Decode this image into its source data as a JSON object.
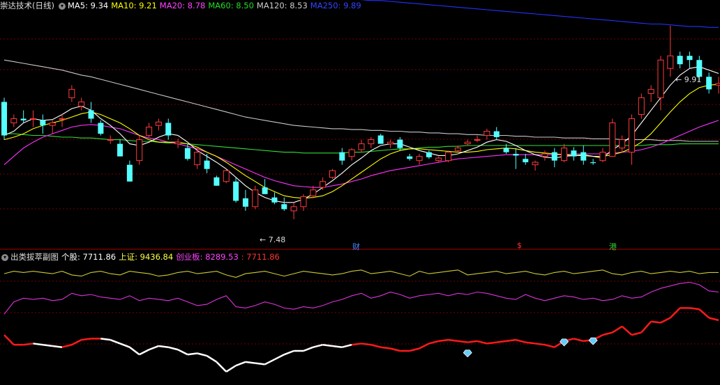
{
  "main_panel": {
    "title": "崇达技术(日线)",
    "ma_labels": [
      {
        "text": "MA5: 9.34",
        "color": "#ffffff"
      },
      {
        "text": "MA10: 9.21",
        "color": "#ffff00"
      },
      {
        "text": "MA20: 8.78",
        "color": "#ff44ff"
      },
      {
        "text": "MA60: 8.50",
        "color": "#22dd22"
      },
      {
        "text": "MA120: 8.53",
        "color": "#cccccc"
      },
      {
        "text": "MA250: 9.89",
        "color": "#3344ff"
      }
    ],
    "price_high_label": "9.91",
    "price_low_label": "7.48",
    "event_marks": [
      {
        "text": "财",
        "color": "#4488ff"
      },
      {
        "text": "$",
        "color": "#ff3333"
      },
      {
        "text": "港",
        "color": "#33cc33"
      }
    ]
  },
  "sub_panel": {
    "title": "出类拔萃副图",
    "labels": [
      {
        "text": "个股: 7711.86",
        "color": "#ffffff"
      },
      {
        "text": "上证: 9436.84",
        "color": "#ffff44"
      },
      {
        "text": "创业板: 8289.53",
        "color": "#ff44ff"
      },
      {
        "text": ": 7711.86",
        "color": "#ff3333"
      }
    ]
  },
  "colors": {
    "up": "#ff3b3b",
    "down": "#54ffff",
    "grid": "#7a0000",
    "ma5": "#ffffff",
    "ma10": "#ffff00",
    "ma20": "#ff33ff",
    "ma60": "#33dd33",
    "ma120": "#c8c8c8",
    "ma250": "#2233ff",
    "sub_yellow": "#cccc33",
    "sub_magenta": "#dd33dd",
    "sub_white": "#ffffff",
    "sub_red": "#ff1a1a",
    "diamond": "#66ccff"
  },
  "chart_data": [
    {
      "type": "candlestick",
      "title": "崇达技术(日线)",
      "y_range": [
        7.35,
        10.1
      ],
      "candles_ohlc": [
        [
          9.0,
          9.05,
          8.55,
          8.6
        ],
        [
          8.75,
          8.85,
          8.7,
          8.8
        ],
        [
          8.8,
          8.9,
          8.75,
          8.78
        ],
        [
          8.8,
          8.9,
          8.7,
          8.8
        ],
        [
          8.78,
          8.85,
          8.62,
          8.72
        ],
        [
          8.72,
          8.78,
          8.62,
          8.75
        ],
        [
          8.8,
          8.85,
          8.7,
          8.8
        ],
        [
          9.05,
          9.2,
          9.0,
          9.15
        ],
        [
          8.95,
          9.05,
          8.9,
          9.0
        ],
        [
          8.9,
          9.0,
          8.75,
          8.8
        ],
        [
          8.75,
          8.78,
          8.6,
          8.62
        ],
        [
          8.55,
          8.6,
          8.5,
          8.55
        ],
        [
          8.5,
          8.55,
          8.35,
          8.35
        ],
        [
          8.25,
          8.3,
          8.05,
          8.05
        ],
        [
          8.3,
          8.6,
          8.25,
          8.55
        ],
        [
          8.6,
          8.75,
          8.58,
          8.7
        ],
        [
          8.72,
          8.8,
          8.66,
          8.76
        ],
        [
          8.75,
          8.8,
          8.55,
          8.6
        ],
        [
          8.5,
          8.56,
          8.45,
          8.52
        ],
        [
          8.45,
          8.5,
          8.3,
          8.32
        ],
        [
          8.25,
          8.45,
          8.2,
          8.4
        ],
        [
          8.3,
          8.38,
          8.15,
          8.2
        ],
        [
          8.1,
          8.12,
          8.0,
          8.0
        ],
        [
          8.05,
          8.2,
          8.03,
          8.18
        ],
        [
          8.05,
          8.1,
          7.8,
          7.82
        ],
        [
          7.85,
          7.95,
          7.7,
          7.75
        ],
        [
          7.75,
          8.0,
          7.72,
          7.95
        ],
        [
          7.98,
          8.08,
          7.9,
          7.9
        ],
        [
          7.86,
          7.92,
          7.78,
          7.8
        ],
        [
          7.78,
          7.86,
          7.7,
          7.72
        ],
        [
          7.7,
          7.8,
          7.6,
          7.75
        ],
        [
          7.75,
          7.9,
          7.7,
          7.87
        ],
        [
          7.88,
          8.0,
          7.85,
          7.95
        ],
        [
          7.98,
          8.1,
          7.95,
          8.05
        ],
        [
          8.1,
          8.2,
          8.08,
          8.18
        ],
        [
          8.4,
          8.45,
          8.25,
          8.3
        ],
        [
          8.35,
          8.45,
          8.3,
          8.43
        ],
        [
          8.43,
          8.55,
          8.4,
          8.5
        ],
        [
          8.5,
          8.58,
          8.45,
          8.55
        ],
        [
          8.6,
          8.62,
          8.5,
          8.5
        ],
        [
          8.5,
          8.55,
          8.45,
          8.52
        ],
        [
          8.55,
          8.58,
          8.42,
          8.45
        ],
        [
          8.35,
          8.38,
          8.3,
          8.32
        ],
        [
          8.3,
          8.38,
          8.25,
          8.35
        ],
        [
          8.4,
          8.42,
          8.32,
          8.34
        ],
        [
          8.3,
          8.35,
          8.28,
          8.33
        ],
        [
          8.3,
          8.42,
          8.28,
          8.4
        ],
        [
          8.42,
          8.48,
          8.4,
          8.45
        ],
        [
          8.5,
          8.55,
          8.48,
          8.52
        ],
        [
          8.55,
          8.6,
          8.52,
          8.55
        ],
        [
          8.6,
          8.68,
          8.55,
          8.65
        ],
        [
          8.65,
          8.7,
          8.55,
          8.58
        ],
        [
          8.45,
          8.5,
          8.38,
          8.4
        ],
        [
          8.38,
          8.45,
          8.2,
          8.36
        ],
        [
          8.32,
          8.38,
          8.25,
          8.28
        ],
        [
          8.25,
          8.3,
          8.18,
          8.28
        ],
        [
          8.35,
          8.42,
          8.3,
          8.38
        ],
        [
          8.4,
          8.45,
          8.22,
          8.3
        ],
        [
          8.3,
          8.5,
          8.28,
          8.45
        ],
        [
          8.42,
          8.46,
          8.3,
          8.35
        ],
        [
          8.4,
          8.48,
          8.25,
          8.3
        ],
        [
          8.28,
          8.32,
          8.25,
          8.27
        ],
        [
          8.3,
          8.45,
          8.28,
          8.4
        ],
        [
          8.35,
          8.8,
          8.35,
          8.75
        ],
        [
          8.45,
          8.6,
          8.4,
          8.55
        ],
        [
          8.4,
          8.85,
          8.25,
          8.8
        ],
        [
          8.85,
          9.1,
          8.8,
          9.05
        ],
        [
          9.1,
          9.2,
          9.0,
          9.15
        ],
        [
          9.05,
          9.55,
          8.9,
          9.5
        ],
        [
          9.4,
          9.91,
          9.3,
          9.55
        ],
        [
          9.55,
          9.6,
          9.4,
          9.45
        ],
        [
          9.55,
          9.6,
          9.4,
          9.5
        ],
        [
          9.5,
          9.55,
          9.25,
          9.3
        ],
        [
          9.3,
          9.35,
          9.1,
          9.15
        ],
        [
          9.2,
          9.3,
          9.1,
          9.22
        ]
      ],
      "ma_series": {
        "MA5": [
          8.6,
          8.65,
          8.75,
          8.8,
          8.78,
          8.79,
          8.85,
          8.92,
          8.95,
          8.9,
          8.8,
          8.72,
          8.62,
          8.5,
          8.48,
          8.52,
          8.58,
          8.62,
          8.6,
          8.52,
          8.42,
          8.35,
          8.28,
          8.2,
          8.1,
          8.0,
          7.92,
          7.86,
          7.82,
          7.8,
          7.8,
          7.84,
          7.9,
          7.98,
          8.06,
          8.15,
          8.25,
          8.33,
          8.42,
          8.48,
          8.5,
          8.5,
          8.46,
          8.42,
          8.39,
          8.36,
          8.36,
          8.38,
          8.42,
          8.46,
          8.52,
          8.55,
          8.53,
          8.48,
          8.42,
          8.37,
          8.34,
          8.33,
          8.35,
          8.36,
          8.37,
          8.35,
          8.33,
          8.43,
          8.5,
          8.6,
          8.75,
          8.9,
          9.05,
          9.2,
          9.32,
          9.4,
          9.42,
          9.38,
          9.34
        ],
        "MA10": [
          8.55,
          8.58,
          8.62,
          8.68,
          8.72,
          8.75,
          8.78,
          8.82,
          8.86,
          8.88,
          8.85,
          8.8,
          8.75,
          8.68,
          8.6,
          8.55,
          8.52,
          8.52,
          8.52,
          8.5,
          8.46,
          8.4,
          8.35,
          8.28,
          8.2,
          8.12,
          8.05,
          7.98,
          7.93,
          7.88,
          7.86,
          7.85,
          7.86,
          7.88,
          7.93,
          8.0,
          8.08,
          8.16,
          8.24,
          8.32,
          8.38,
          8.42,
          8.44,
          8.44,
          8.43,
          8.42,
          8.41,
          8.4,
          8.4,
          8.41,
          8.43,
          8.44,
          8.45,
          8.44,
          8.42,
          8.4,
          8.39,
          8.38,
          8.37,
          8.36,
          8.36,
          8.35,
          8.35,
          8.37,
          8.4,
          8.45,
          8.52,
          8.62,
          8.75,
          8.88,
          9.0,
          9.1,
          9.17,
          9.2,
          9.21
        ],
        "MA20": [
          8.25,
          8.35,
          8.45,
          8.52,
          8.58,
          8.62,
          8.66,
          8.7,
          8.72,
          8.73,
          8.72,
          8.7,
          8.68,
          8.64,
          8.6,
          8.57,
          8.55,
          8.52,
          8.5,
          8.47,
          8.44,
          8.4,
          8.35,
          8.3,
          8.25,
          8.2,
          8.15,
          8.1,
          8.06,
          8.03,
          8.0,
          7.99,
          7.98,
          7.98,
          8.0,
          8.02,
          8.05,
          8.08,
          8.12,
          8.15,
          8.18,
          8.2,
          8.22,
          8.24,
          8.26,
          8.28,
          8.3,
          8.32,
          8.33,
          8.34,
          8.35,
          8.36,
          8.37,
          8.37,
          8.37,
          8.37,
          8.37,
          8.37,
          8.37,
          8.38,
          8.38,
          8.38,
          8.38,
          8.39,
          8.4,
          8.41,
          8.43,
          8.46,
          8.5,
          8.55,
          8.6,
          8.65,
          8.7,
          8.74,
          8.78
        ],
        "MA60": [
          8.62,
          8.62,
          8.61,
          8.6,
          8.6,
          8.59,
          8.58,
          8.58,
          8.57,
          8.57,
          8.56,
          8.55,
          8.55,
          8.54,
          8.53,
          8.53,
          8.52,
          8.51,
          8.51,
          8.5,
          8.49,
          8.48,
          8.47,
          8.46,
          8.45,
          8.44,
          8.43,
          8.42,
          8.41,
          8.4,
          8.4,
          8.39,
          8.39,
          8.39,
          8.39,
          8.39,
          8.4,
          8.4,
          8.41,
          8.42,
          8.43,
          8.44,
          8.44,
          8.45,
          8.46,
          8.46,
          8.47,
          8.47,
          8.48,
          8.48,
          8.48,
          8.48,
          8.48,
          8.48,
          8.48,
          8.48,
          8.48,
          8.48,
          8.48,
          8.48,
          8.48,
          8.48,
          8.48,
          8.48,
          8.48,
          8.48,
          8.48,
          8.49,
          8.49,
          8.49,
          8.5,
          8.5,
          8.5,
          8.5,
          8.5
        ],
        "MA120": [
          9.5,
          9.48,
          9.46,
          9.44,
          9.42,
          9.4,
          9.38,
          9.35,
          9.32,
          9.3,
          9.27,
          9.24,
          9.21,
          9.18,
          9.15,
          9.12,
          9.09,
          9.06,
          9.03,
          9.0,
          8.97,
          8.94,
          8.91,
          8.88,
          8.85,
          8.82,
          8.8,
          8.78,
          8.76,
          8.74,
          8.72,
          8.71,
          8.7,
          8.69,
          8.68,
          8.68,
          8.67,
          8.67,
          8.66,
          8.66,
          8.65,
          8.65,
          8.64,
          8.64,
          8.63,
          8.63,
          8.62,
          8.62,
          8.61,
          8.61,
          8.6,
          8.6,
          8.6,
          8.59,
          8.59,
          8.58,
          8.58,
          8.58,
          8.57,
          8.57,
          8.57,
          8.56,
          8.56,
          8.56,
          8.55,
          8.55,
          8.55,
          8.55,
          8.54,
          8.54,
          8.54,
          8.53,
          8.53,
          8.53,
          8.53
        ],
        "MA250": [
          10.52,
          10.51,
          10.5,
          10.49,
          10.49,
          10.48,
          10.47,
          10.46,
          10.45,
          10.45,
          10.44,
          10.43,
          10.42,
          10.42,
          10.41,
          10.4,
          10.39,
          10.39,
          10.38,
          10.37,
          10.36,
          10.36,
          10.35,
          10.34,
          10.33,
          10.32,
          10.32,
          10.31,
          10.3,
          10.29,
          10.28,
          10.27,
          10.27,
          10.26,
          10.25,
          10.24,
          10.23,
          10.22,
          10.21,
          10.21,
          10.2,
          10.19,
          10.18,
          10.17,
          10.16,
          10.15,
          10.14,
          10.13,
          10.12,
          10.11,
          10.1,
          10.09,
          10.08,
          10.07,
          10.06,
          10.05,
          10.04,
          10.03,
          10.02,
          10.01,
          10.0,
          9.99,
          9.98,
          9.97,
          9.96,
          9.95,
          9.94,
          9.93,
          9.93,
          9.92,
          9.91,
          9.9,
          9.9,
          9.89,
          9.89
        ]
      }
    },
    {
      "type": "line",
      "title": "出类拔萃副图",
      "y_range": [
        0,
        100
      ],
      "series": [
        {
          "name": "上证",
          "color": "#cccc33",
          "values": [
            88,
            90,
            89,
            90,
            89,
            88,
            90,
            87,
            86,
            89,
            90,
            88,
            87,
            90,
            89,
            88,
            86,
            87,
            89,
            90,
            88,
            89,
            90,
            87,
            85,
            88,
            89,
            90,
            88,
            86,
            88,
            90,
            89,
            88,
            87,
            88,
            90,
            91,
            88,
            89,
            90,
            88,
            86,
            90,
            88,
            89,
            90,
            91,
            87,
            88,
            89,
            90,
            88,
            89,
            90,
            88,
            87,
            89,
            90,
            88,
            89,
            90,
            91,
            88,
            87,
            89,
            90,
            88,
            89,
            90,
            89,
            90,
            88,
            89,
            89
          ]
        },
        {
          "name": "创业板",
          "color": "#dd33dd",
          "values": [
            55,
            65,
            68,
            67,
            68,
            66,
            67,
            72,
            70,
            71,
            69,
            68,
            67,
            70,
            66,
            68,
            67,
            66,
            68,
            65,
            62,
            63,
            67,
            70,
            61,
            60,
            62,
            65,
            63,
            60,
            59,
            61,
            60,
            62,
            65,
            67,
            70,
            72,
            68,
            70,
            73,
            71,
            68,
            70,
            71,
            72,
            70,
            72,
            71,
            73,
            72,
            70,
            68,
            67,
            71,
            68,
            66,
            68,
            70,
            69,
            67,
            68,
            66,
            67,
            70,
            68,
            69,
            73,
            76,
            78,
            80,
            81,
            79,
            74,
            73
          ]
        },
        {
          "name": "个股",
          "color": "#ffffff",
          "values": [
            38,
            30,
            30,
            31,
            30,
            29,
            28,
            30,
            34,
            35,
            35,
            34,
            31,
            28,
            22,
            26,
            29,
            28,
            26,
            22,
            23,
            21,
            16,
            8,
            13,
            16,
            15,
            14,
            18,
            22,
            25,
            25,
            28,
            30,
            29,
            28,
            30,
            31,
            30,
            28,
            27,
            25,
            25,
            27,
            31,
            33,
            34,
            33,
            32,
            33,
            31,
            32,
            33,
            34,
            32,
            31,
            30,
            28,
            33,
            35,
            33,
            34,
            38,
            40,
            45,
            38,
            40,
            49,
            48,
            52,
            60,
            60,
            59,
            52,
            50
          ]
        }
      ]
    }
  ]
}
